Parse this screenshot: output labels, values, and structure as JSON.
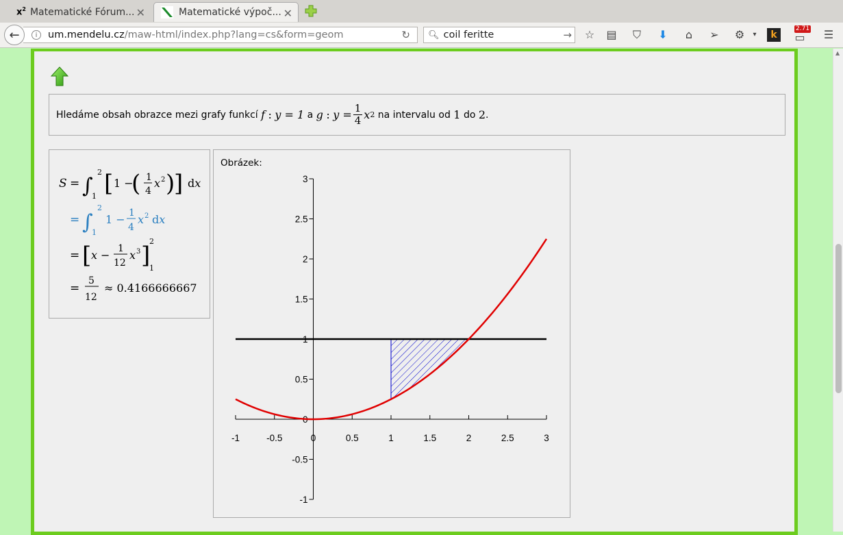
{
  "browser": {
    "tabs": [
      {
        "title": "Matematické Fórum...",
        "favicon": "x2"
      },
      {
        "title": "Matematické výpoč...",
        "favicon": "mendelu-icon"
      }
    ],
    "url": {
      "domain": "um.mendelu.cz",
      "path": "/maw-html/index.php?lang=cs&form=geom"
    },
    "search": {
      "value": "coil feritte"
    },
    "badge": "2.71"
  },
  "problem": {
    "text_before": "Hledáme obsah obrazce mezi grafy funkcí",
    "f_label": "f",
    "f_expr": "y = 1",
    "and": "a",
    "g_label": "g",
    "g_expr_prefix": "y =",
    "g_num": "1",
    "g_den": "4",
    "g_var": "x",
    "g_exp": "2",
    "text_after": "na intervalu od",
    "a": "1",
    "do": "do",
    "b": "2",
    "period": "."
  },
  "solution": {
    "lhs": "S",
    "line1": "1 − (1/4 x²) dx",
    "line2": "1 − 1/4 x² dx",
    "line3": "x − 1/12 x³",
    "line4_num": "5",
    "line4_den": "12",
    "line4_approx": "≈ 0.4166666667",
    "lower": "1",
    "upper": "2"
  },
  "figure": {
    "label": "Obrázek:"
  },
  "chart_data": {
    "type": "line",
    "xlim": [
      -1,
      3
    ],
    "ylim": [
      -1,
      3
    ],
    "x_ticks": [
      "-1",
      "-0.5",
      "0",
      "0.5",
      "1",
      "1.5",
      "2",
      "2.5",
      "3"
    ],
    "y_ticks": [
      "-1",
      "-0.5",
      "0",
      "0.5",
      "1",
      "1.5",
      "2",
      "2.5",
      "3"
    ],
    "series": [
      {
        "expr": "y = 1",
        "color": "#000000",
        "x": [
          -1,
          3
        ],
        "y": [
          1,
          1
        ]
      },
      {
        "expr": "y = x^2/4",
        "color": "#e00000",
        "x": [
          -1,
          -0.5,
          0,
          0.5,
          1,
          1.5,
          2,
          2.5,
          3
        ],
        "y": [
          0.25,
          0.0625,
          0,
          0.0625,
          0.25,
          0.5625,
          1,
          1.5625,
          2.25
        ]
      }
    ],
    "shaded_region": {
      "x_from": 1,
      "x_to": 2,
      "between": [
        "y = x^2/4",
        "y = 1"
      ],
      "color": "#0000cc",
      "pattern": "hatch"
    },
    "grid": false
  }
}
